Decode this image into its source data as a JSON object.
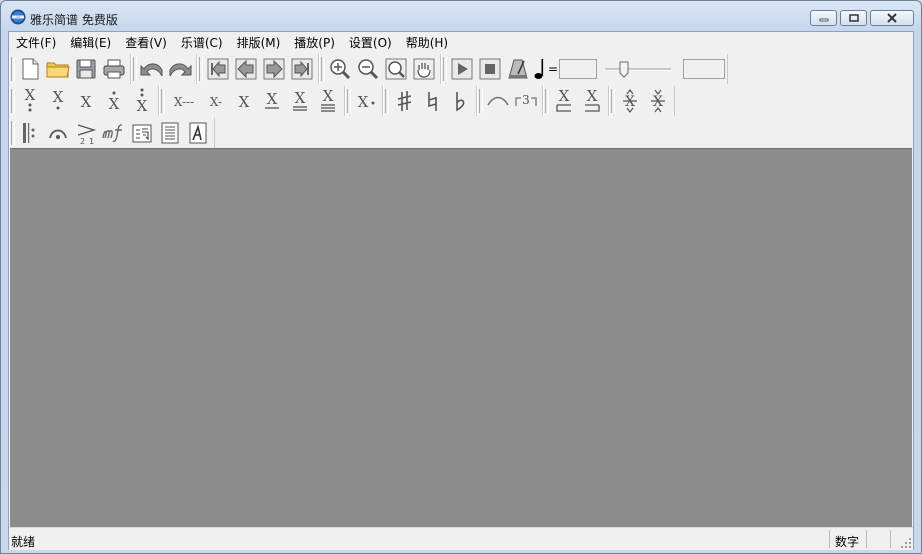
{
  "window": {
    "title": "雅乐简谱 免费版"
  },
  "menu": [
    {
      "label": "文件(F)"
    },
    {
      "label": "编辑(E)"
    },
    {
      "label": "查看(V)"
    },
    {
      "label": "乐谱(C)"
    },
    {
      "label": "排版(M)"
    },
    {
      "label": "播放(P)"
    },
    {
      "label": "设置(O)"
    },
    {
      "label": "帮助(H)"
    }
  ],
  "toolbar1": {
    "icons": [
      "new-file-icon",
      "open-folder-icon",
      "save-icon",
      "print-icon",
      "undo-icon",
      "redo-icon",
      "first-page-icon",
      "prev-page-icon",
      "next-page-icon",
      "last-page-icon",
      "zoom-in-icon",
      "zoom-out-icon",
      "zoom-fit-icon",
      "hand-pan-icon",
      "play-icon",
      "stop-icon",
      "metronome-icon",
      "quarter-note-icon"
    ],
    "tempo_equals": "=",
    "tempo_value": "",
    "volume_value": ""
  },
  "toolbar2": {
    "note_glyph": "X",
    "duration_whole": "X---",
    "duration_half": "X-",
    "dotted_dot": "•",
    "triplet_label": "3"
  },
  "status": {
    "ready": "就绪",
    "num_lock": "数字"
  },
  "colors": {
    "canvas": "#8c8c8c",
    "chrome": "#f0f0f0",
    "title_gradient_top": "#dae6f4"
  }
}
